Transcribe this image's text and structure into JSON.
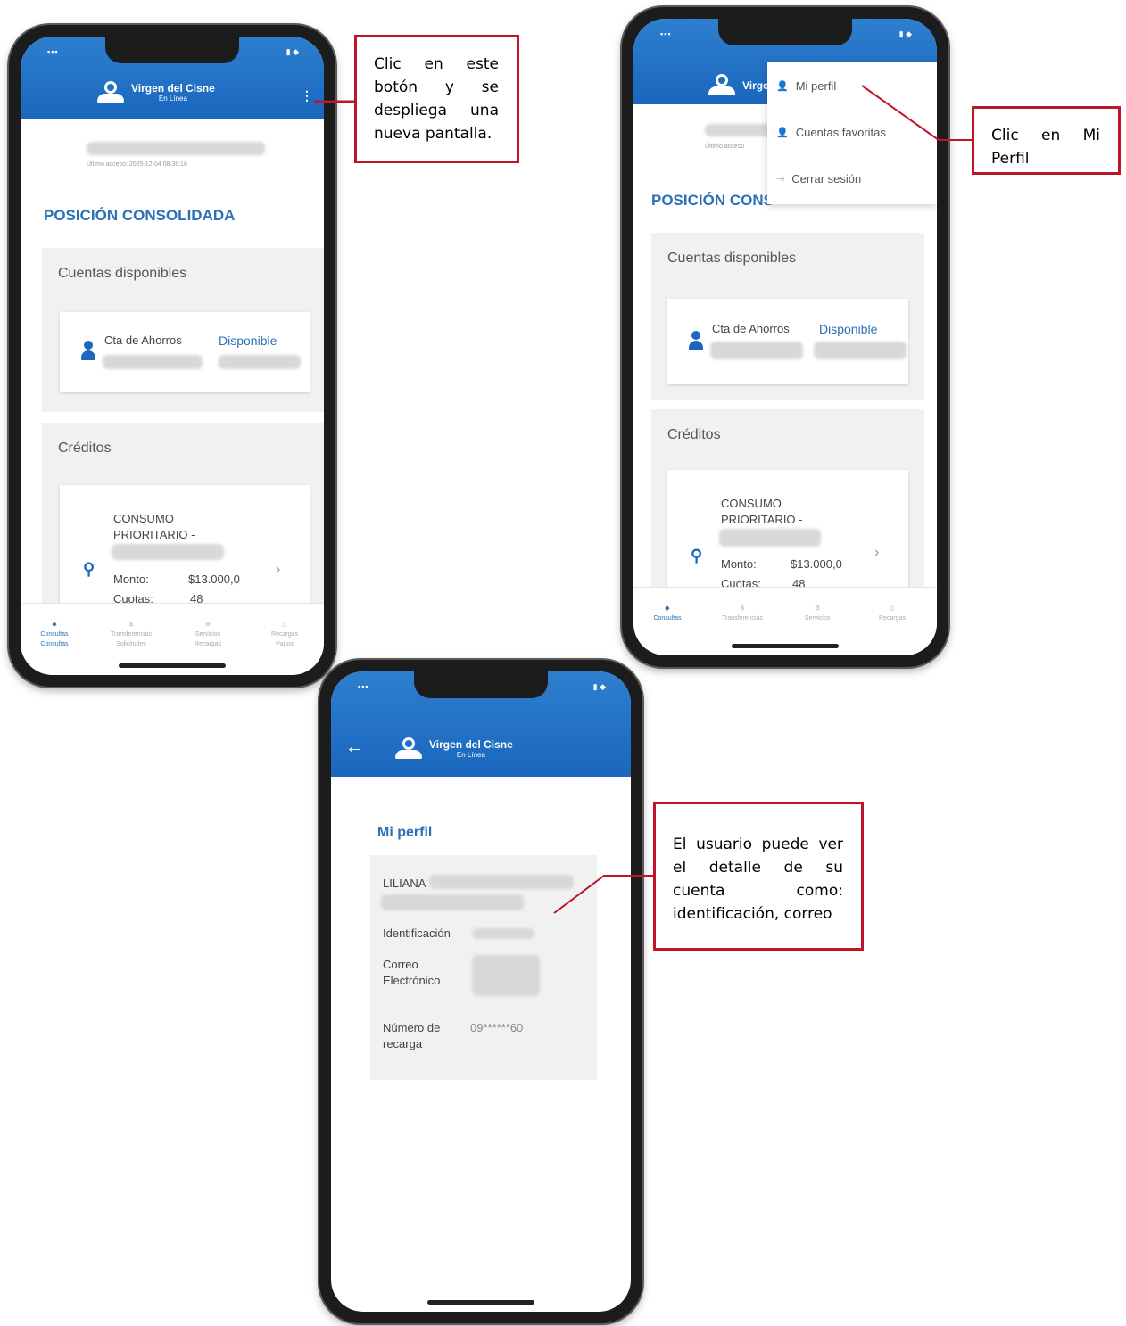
{
  "app": {
    "name": "Virgen del Cisne",
    "subtitle": "En Línea"
  },
  "screen1": {
    "last_access": "Último acceso: 2025-12-04 08:38:16",
    "section_title": "POSICIÓN CONSOLIDADA",
    "accounts_card_title": "Cuentas disponibles",
    "account_type": "Cta de Ahorros",
    "available_label": "Disponible",
    "credits_card_title": "Créditos",
    "credit_name_line1": "CONSUMO",
    "credit_name_line2": "PRIORITARIO -",
    "amount_label": "Monto:",
    "amount_value": "$13.000,0",
    "installments_label": "Cuotas:",
    "installments_value": "48"
  },
  "nav": {
    "items": [
      "Consultas",
      "Transferencias",
      "Servicios",
      "Recargas"
    ],
    "sub_items": [
      "Consultas",
      "Solicitudes",
      "Recargas",
      "Pagos"
    ]
  },
  "screen2": {
    "menu": {
      "items": [
        "Mi perfil",
        "Cuentas favoritas",
        "Cerrar sesión"
      ]
    },
    "section_title": "POSICIÓN CONS",
    "last_access": "Último acceso",
    "accounts_card_title": "Cuentas disponibles",
    "account_type": "Cta de Ahorros",
    "available_label": "Disponible",
    "credits_card_title": "Créditos",
    "credit_name_line1": "CONSUMO",
    "credit_name_line2": "PRIORITARIO -",
    "amount_label": "Monto:",
    "amount_value": "$13.000,0",
    "installments_label": "Cuotas:",
    "installments_value": "48"
  },
  "screen3": {
    "title": "Mi perfil",
    "user_name": "LILIANA",
    "id_label": "Identificación",
    "email_label_line1": "Correo",
    "email_label_line2": "Electrónico",
    "recharge_label_line1": "Número de",
    "recharge_label_line2": "recarga",
    "recharge_value": "09******60"
  },
  "callouts": {
    "one": "Clic en este botón y se despliega una nueva pantalla.",
    "two": "Clic en Mi Perfil",
    "three": "El usuario puede ver el detalle de su cuenta como: identificación, correo"
  },
  "colors": {
    "header_blue": "#1a67bd",
    "accent_blue": "#2a71b8",
    "callout_red": "#c0142a"
  },
  "icons": {
    "back": "arrow-left-icon",
    "kebab": "kebab-menu-icon",
    "person": "person-icon",
    "chevron": "chevron-right-icon"
  }
}
